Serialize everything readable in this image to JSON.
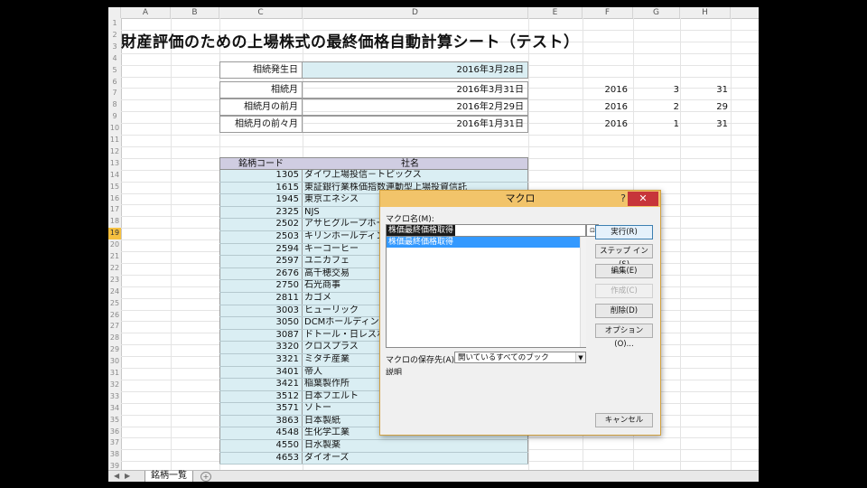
{
  "spreadsheet": {
    "columns": [
      "A",
      "B",
      "C",
      "D",
      "E",
      "F",
      "G",
      "H"
    ],
    "rows": [
      "1",
      "2",
      "3",
      "4",
      "5",
      "6",
      "7",
      "8",
      "9",
      "10",
      "11",
      "12",
      "13",
      "14",
      "15",
      "16",
      "17",
      "18",
      "19",
      "20",
      "21",
      "22",
      "23",
      "24",
      "25",
      "26",
      "27",
      "28",
      "29",
      "30",
      "31",
      "32",
      "33",
      "34",
      "35",
      "36",
      "37",
      "38",
      "39"
    ],
    "selected_row": "19",
    "title": "財産評価のための上場株式の最終価格自動計算シート（テスト）",
    "info": [
      {
        "label": "相続発生日",
        "value": "2016年3月28日",
        "year": "",
        "month": "",
        "day": ""
      },
      {
        "label": "相続月",
        "value": "2016年3月31日",
        "year": "2016",
        "month": "3",
        "day": "31"
      },
      {
        "label": "相続月の前月",
        "value": "2016年2月29日",
        "year": "2016",
        "month": "2",
        "day": "29"
      },
      {
        "label": "相続月の前々月",
        "value": "2016年1月31日",
        "year": "2016",
        "month": "1",
        "day": "31"
      }
    ],
    "table_headers": {
      "code": "銘柄コード",
      "name": "社名"
    },
    "stocks": [
      {
        "code": "1305",
        "name": "ダイワ上場投信－トピックス"
      },
      {
        "code": "1615",
        "name": "東証銀行業株価指数連動型上場投資信託"
      },
      {
        "code": "1945",
        "name": "東京エネシス"
      },
      {
        "code": "2325",
        "name": "NJS"
      },
      {
        "code": "2502",
        "name": "アサヒグループホールディングス"
      },
      {
        "code": "2503",
        "name": "キリンホールディングス"
      },
      {
        "code": "2594",
        "name": "キーコーヒー"
      },
      {
        "code": "2597",
        "name": "ユニカフェ"
      },
      {
        "code": "2676",
        "name": "高千穂交易"
      },
      {
        "code": "2750",
        "name": "石光商事"
      },
      {
        "code": "2811",
        "name": "カゴメ"
      },
      {
        "code": "3003",
        "name": "ヒューリック"
      },
      {
        "code": "3050",
        "name": "DCMホールディングス"
      },
      {
        "code": "3087",
        "name": "ドトール・日レスホールディングス"
      },
      {
        "code": "3320",
        "name": "クロスプラス"
      },
      {
        "code": "3321",
        "name": "ミタチ産業"
      },
      {
        "code": "3401",
        "name": "帝人"
      },
      {
        "code": "3421",
        "name": "稲葉製作所"
      },
      {
        "code": "3512",
        "name": "日本フエルト"
      },
      {
        "code": "3571",
        "name": "ソトー"
      },
      {
        "code": "3863",
        "name": "日本製紙"
      },
      {
        "code": "4548",
        "name": "生化学工業"
      },
      {
        "code": "4550",
        "name": "日水製薬"
      },
      {
        "code": "4653",
        "name": "ダイオーズ"
      }
    ],
    "sheet_tab": "銘柄一覧",
    "add_sheet": "+"
  },
  "dialog": {
    "title": "マクロ",
    "help": "?",
    "close": "✕",
    "macro_name_label": "マクロ名(M):",
    "macro_name_value": "株価最終価格取得",
    "macros": [
      "株価最終価格取得"
    ],
    "buttons": {
      "run": "実行(R)",
      "step_in": "ステップ イン(S)",
      "edit": "編集(E)",
      "create": "作成(C)",
      "delete": "削除(D)",
      "options": "オプション(O)...",
      "cancel": "キャンセル"
    },
    "store_label": "マクロの保存先(A):",
    "store_value": "開いているすべてのブック",
    "description_label": "説明"
  }
}
